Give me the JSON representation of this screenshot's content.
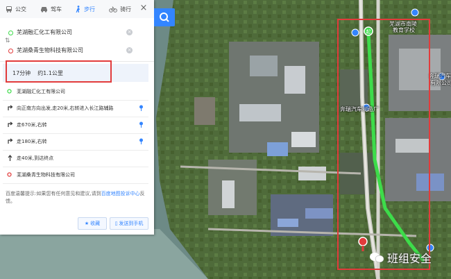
{
  "tabs": [
    {
      "label": "公交",
      "icon": "bus-icon"
    },
    {
      "label": "驾车",
      "icon": "car-icon"
    },
    {
      "label": "步行",
      "icon": "walk-icon"
    },
    {
      "label": "骑行",
      "icon": "bike-icon"
    }
  ],
  "route": {
    "origin": "芜湖融汇化工有限公司",
    "destination": "芜湖桑青生物科技有限公司"
  },
  "summary": {
    "time": "17分钟",
    "distance": "约1.1公里"
  },
  "steps": [
    {
      "text": "芜湖融汇化工有限公司",
      "icon": "start-dot-icon"
    },
    {
      "text": "向正南方向出发,走20米,右转进入长江路辅路",
      "icon": "turn-right-icon"
    },
    {
      "text": "走670米,右转",
      "icon": "turn-right-icon"
    },
    {
      "text": "走180米,右转",
      "icon": "turn-right-icon"
    },
    {
      "text": "走40米,到达终点",
      "icon": "straight-arrow-icon"
    },
    {
      "text": "芜湖桑青生物科技有限公司",
      "icon": "end-dot-icon"
    }
  ],
  "note": {
    "text": "百度温馨提示:如果您有任何意见和建议,请到",
    "link": "百度地图投诉中心",
    "suffix": "反馈。"
  },
  "actions": {
    "favorite": "收藏",
    "send": "发送到手机"
  },
  "map_labels": {
    "school": "芜湖市南陵",
    "school2": "教育学校",
    "hospital": "奔瑞汽车",
    "hospital2": "有限公司",
    "center": "奔瑞汽车制造厂"
  },
  "watermark": "班组安全",
  "colors": {
    "accent": "#3385ff",
    "route": "#3ddc4a",
    "highlight_box": "#e23b3b"
  }
}
